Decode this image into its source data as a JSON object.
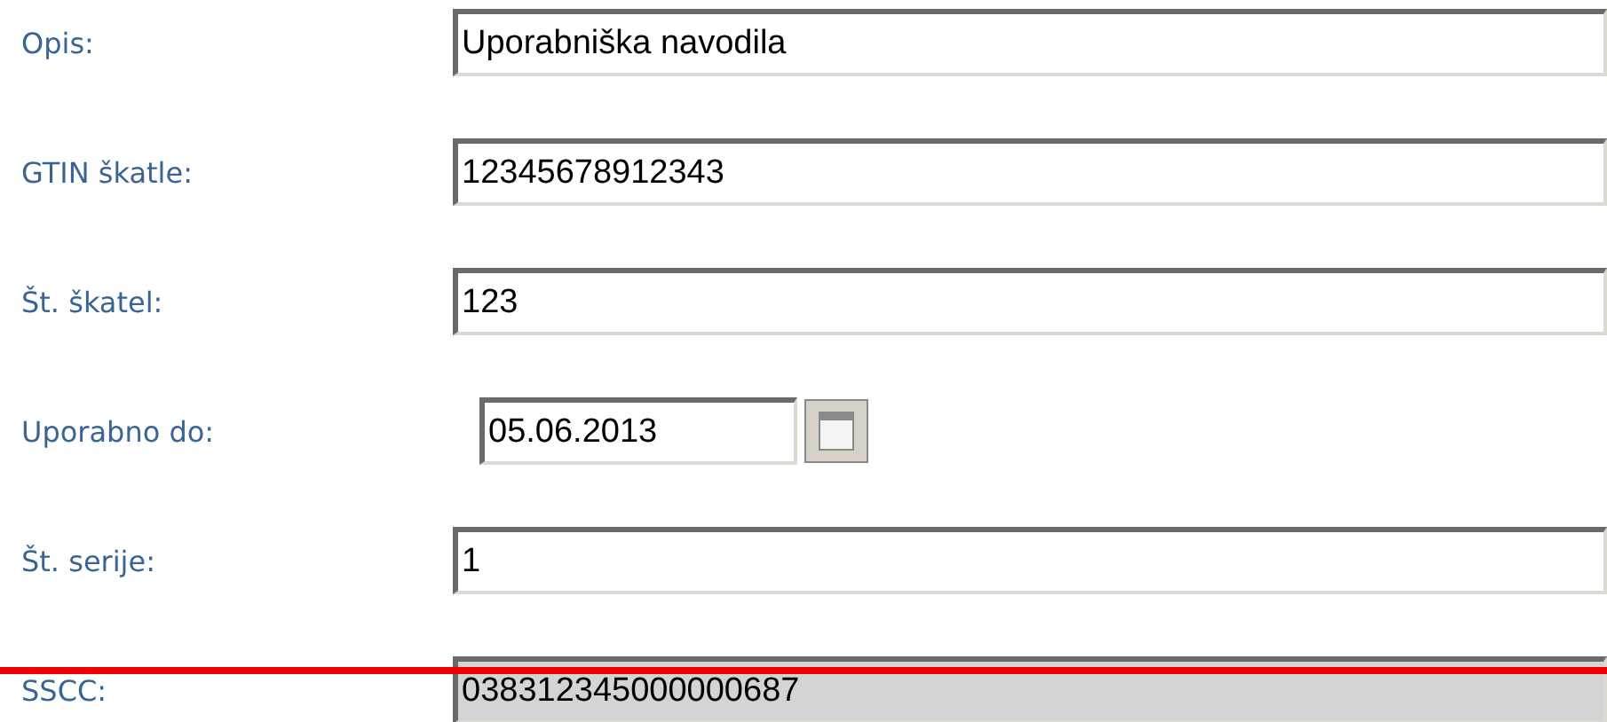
{
  "form": {
    "fields": [
      {
        "label": "Opis:",
        "kind": "text",
        "value": "Uporabniška navodila",
        "disabled": false
      },
      {
        "label": "GTIN škatle:",
        "kind": "text",
        "value": "12345678912343",
        "disabled": false
      },
      {
        "label": "Št. škatel:",
        "kind": "text",
        "value": "123",
        "disabled": false
      },
      {
        "label": "Uporabno do:",
        "kind": "date",
        "value": "05.06.2013",
        "disabled": false
      },
      {
        "label": "Št. serije:",
        "kind": "text",
        "value": "1",
        "disabled": false
      },
      {
        "label": "SSCC:",
        "kind": "text",
        "value": "038312345000000687",
        "disabled": true
      }
    ]
  }
}
